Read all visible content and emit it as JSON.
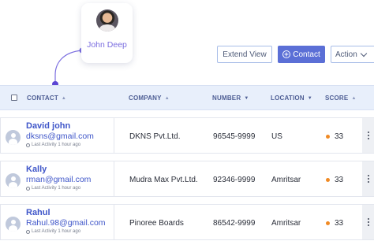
{
  "user_card": {
    "name": "John Deep"
  },
  "toolbar": {
    "extend_label": "Extend View",
    "contact_label": "Contact",
    "action_label": "Action"
  },
  "table": {
    "columns": [
      {
        "label": "CONTACT",
        "sort_icon": "sort-icon"
      },
      {
        "label": "COMPANY",
        "sort_icon": "sort-icon"
      },
      {
        "label": "NUMBER",
        "sort_icon": "sort-down-icon"
      },
      {
        "label": "LOCATION",
        "sort_icon": "sort-down-icon"
      },
      {
        "label": "SCORE",
        "sort_icon": "sort-icon"
      }
    ],
    "rows": [
      {
        "name": "David john",
        "email": "dksns@gmail.com",
        "activity": "Last Activity 1 hour ago",
        "company": "DKNS Pvt.Ltd.",
        "number": "96545-9999",
        "location": "US",
        "score": "33",
        "score_color": "#f08a24"
      },
      {
        "name": "Kally",
        "email": "rman@gmail.com",
        "activity": "Last Activity 1 hour ago",
        "company": "Mudra Max Pvt.Ltd.",
        "number": "92346-9999",
        "location": "Amritsar",
        "score": "33",
        "score_color": "#f08a24"
      },
      {
        "name": "Rahul",
        "email": "Rahul.98@gmail.com",
        "activity": "Last Activity 1 hour ago",
        "company": "Pinoree Boards",
        "number": "86542-9999",
        "location": "Amritsar",
        "score": "33",
        "score_color": "#f08a24"
      }
    ]
  },
  "colors": {
    "accent": "#5b6fd6",
    "link": "#3f56c9",
    "header_bg": "#e8effb",
    "connector": "#7b6ee0"
  }
}
